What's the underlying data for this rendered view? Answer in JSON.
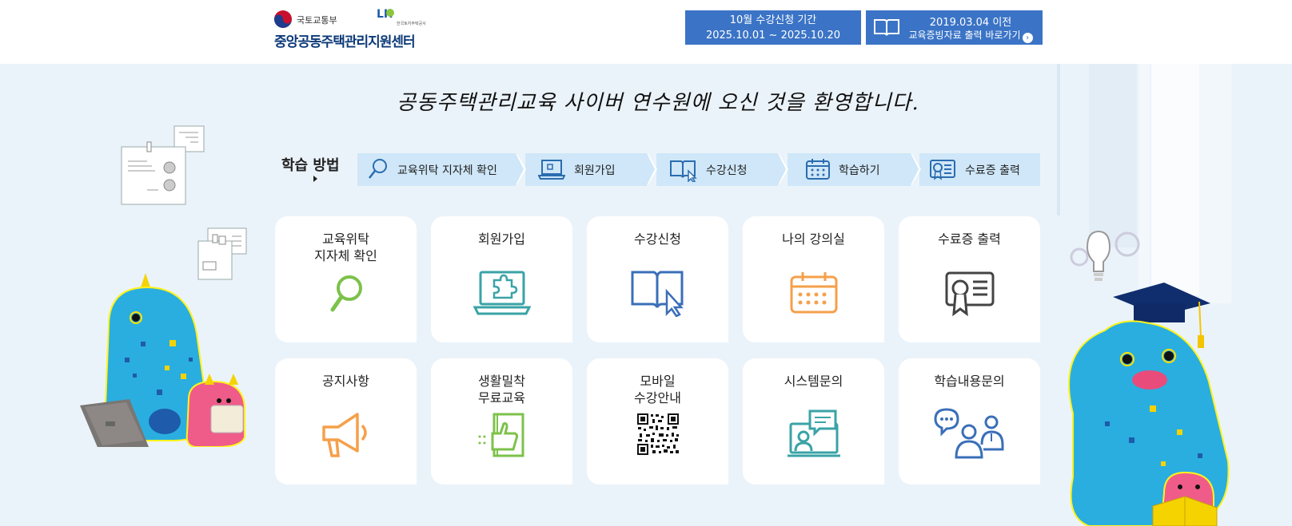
{
  "header": {
    "ministry": "국토교통부",
    "lh_logo": "LH",
    "lh_sub": "한국토지주택공사",
    "center_name": "중앙공동주택관리지원센터",
    "period_button": {
      "line1": "10월 수강신청 기간",
      "line2": "2025.10.01 ~ 2025.10.20"
    },
    "cert_button": {
      "line1": "2019.03.04 이전",
      "line2": "교육증빙자료 출력 바로가기",
      "icon": "chevron-right-icon"
    }
  },
  "welcome": "공동주택관리교육 사이버 연수원에 오신 것을 환영합니다.",
  "steps": {
    "title": "학습 방법",
    "items": [
      {
        "label": "교육위탁 지자체 확인",
        "icon": "search-icon"
      },
      {
        "label": "회원가입",
        "icon": "laptop-icon"
      },
      {
        "label": "수강신청",
        "icon": "book-cursor-icon"
      },
      {
        "label": "학습하기",
        "icon": "calendar-icon"
      },
      {
        "label": "수료증 출력",
        "icon": "certificate-icon"
      }
    ]
  },
  "cards": [
    {
      "line1": "교육위탁",
      "line2": "지자체 확인",
      "icon": "search-icon",
      "color": "#7cc24a"
    },
    {
      "line1": "회원가입",
      "line2": "",
      "icon": "laptop-puzzle-icon",
      "color": "#3aa3a6"
    },
    {
      "line1": "수강신청",
      "line2": "",
      "icon": "book-cursor-icon",
      "color": "#3a6fb8"
    },
    {
      "line1": "나의 강의실",
      "line2": "",
      "icon": "calendar-icon",
      "color": "#f5a04a"
    },
    {
      "line1": "수료증 출력",
      "line2": "",
      "icon": "certificate-icon",
      "color": "#444444"
    },
    {
      "line1": "공지사항",
      "line2": "",
      "icon": "megaphone-icon",
      "color": "#f5a04a"
    },
    {
      "line1": "생활밀착",
      "line2": "무료교육",
      "icon": "thumbs-up-book-icon",
      "color": "#7cc24a"
    },
    {
      "line1": "모바일",
      "line2": "수강안내",
      "icon": "qr-code-icon",
      "color": "#111111"
    },
    {
      "line1": "시스템문의",
      "line2": "",
      "icon": "monitor-chat-icon",
      "color": "#3aa3a6"
    },
    {
      "line1": "학습내용문의",
      "line2": "",
      "icon": "people-chat-icon",
      "color": "#3a6fb8"
    }
  ]
}
